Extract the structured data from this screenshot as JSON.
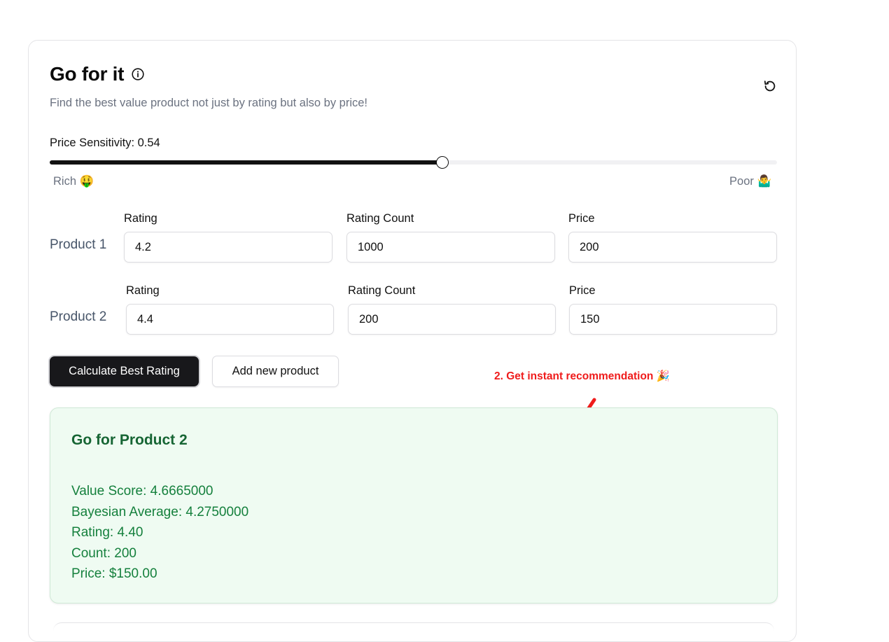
{
  "header": {
    "title": "Go for it",
    "subtitle": "Find the best value product not just by rating but also by price!"
  },
  "sensitivity": {
    "label": "Price Sensitivity: 0.54",
    "value": 0.54,
    "min_label": "Rich 🤑",
    "max_label": "Poor 🤷‍♂️"
  },
  "products": [
    {
      "name": "Product 1",
      "rating_label": "Rating",
      "rating": "4.2",
      "count_label": "Rating Count",
      "count": "1000",
      "price_label": "Price",
      "price": "200"
    },
    {
      "name": "Product 2",
      "rating_label": "Rating",
      "rating": "4.4",
      "count_label": "Rating Count",
      "count": "200",
      "price_label": "Price",
      "price": "150"
    }
  ],
  "actions": {
    "calculate": "Calculate Best Rating",
    "add_product": "Add new product"
  },
  "annotation": "2. Get instant recommendation 🎉",
  "result": {
    "title": "Go for Product 2",
    "value_score": "Value Score: 4.6665000",
    "bayesian": "Bayesian Average: 4.2750000",
    "rating": "Rating: 4.40",
    "count": "Count: 200",
    "price": "Price: $150.00"
  },
  "colors": {
    "primary": "#18181b",
    "success_bg": "#effbf2",
    "success_text": "#15803d",
    "annotation": "#ef1c1c",
    "muted": "#6b7280"
  },
  "icons": [
    "info-icon",
    "reset-icon",
    "arrow-annotation"
  ]
}
